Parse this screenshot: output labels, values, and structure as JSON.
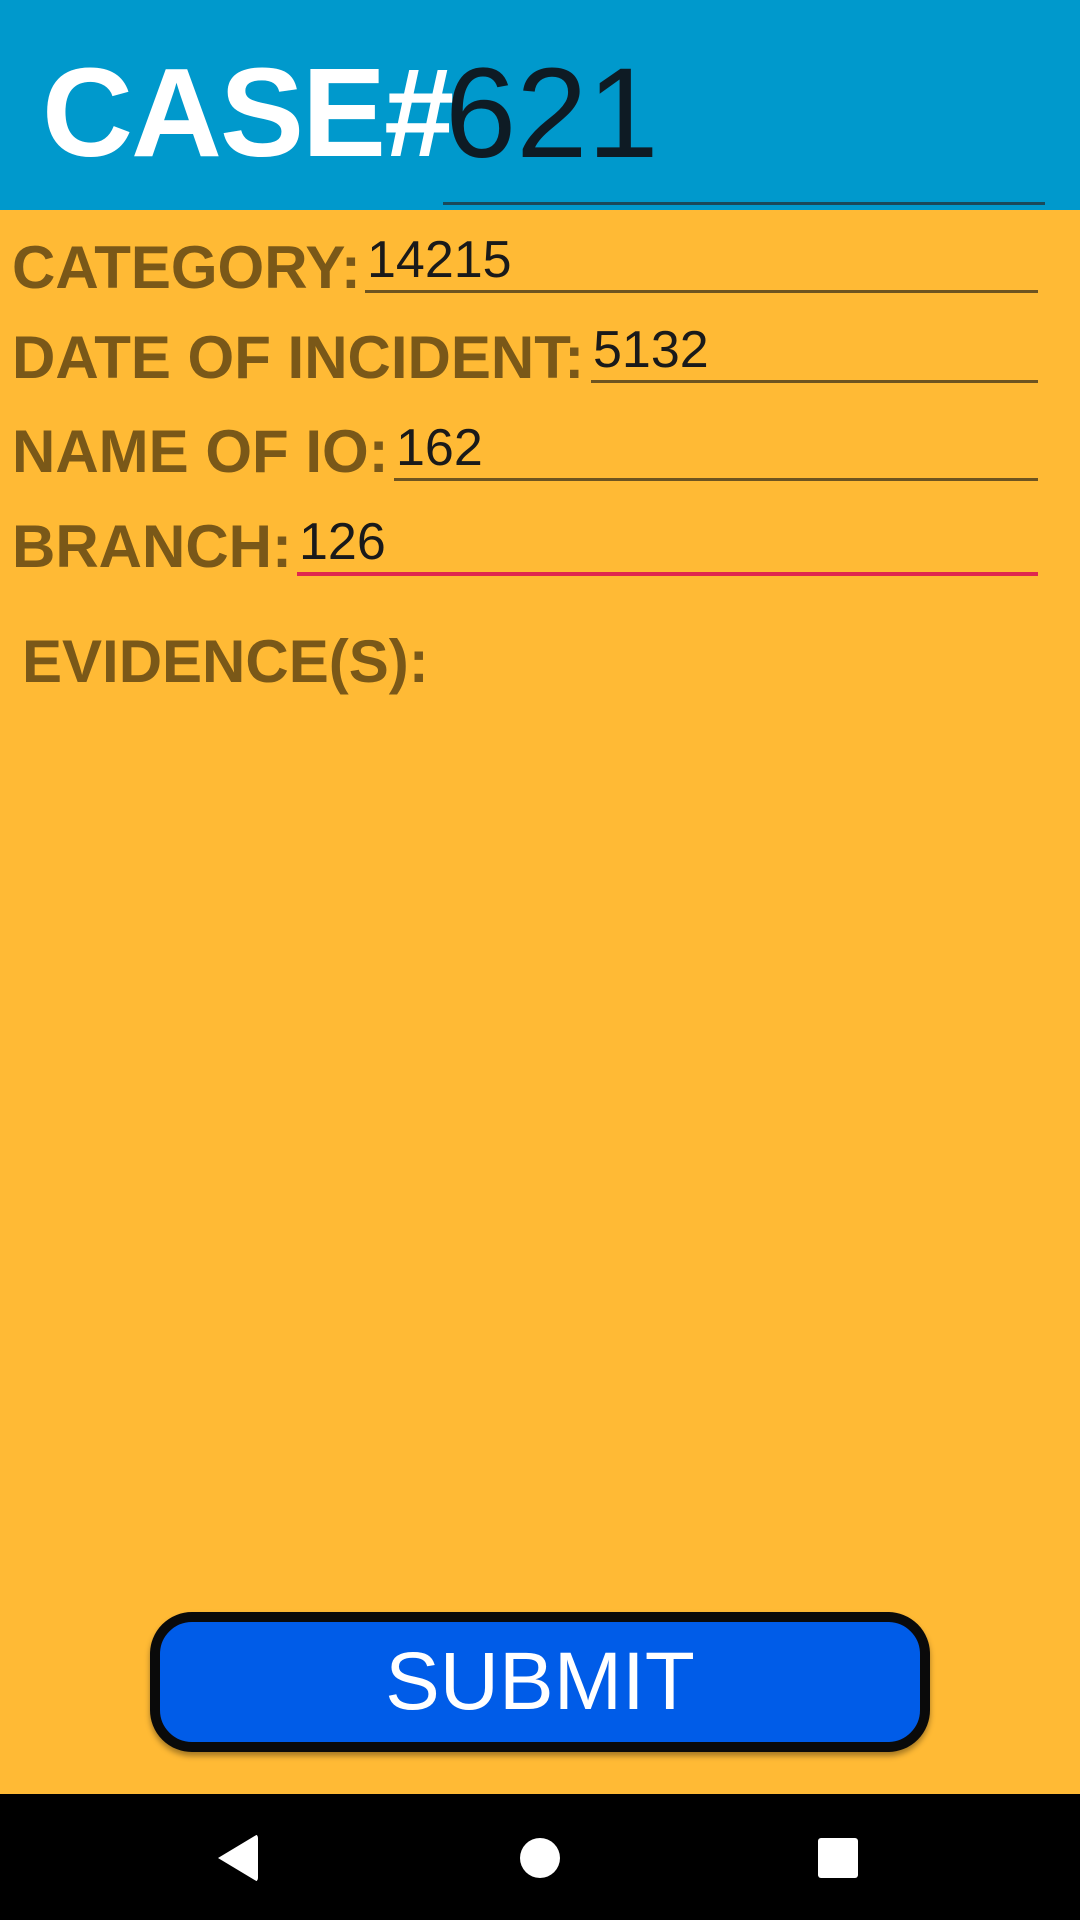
{
  "header": {
    "case_label": "CASE#",
    "case_number": "621",
    "background_color": "#0099CC"
  },
  "form": {
    "background_color": "#FFBA35",
    "fields": [
      {
        "label": "CATEGORY:",
        "value": "14215"
      },
      {
        "label": "DATE OF INCIDENT:",
        "value": "5132"
      },
      {
        "label": "NAME OF IO:",
        "value": "162"
      },
      {
        "label": "BRANCH:",
        "value": "126",
        "focused": true
      }
    ],
    "evidence_label": "EVIDENCE(S):",
    "focus_color": "#E0264E"
  },
  "submit": {
    "label": "SUBMIT",
    "color": "#005CE8"
  },
  "navbar": {
    "back_icon": "back-triangle-icon",
    "home_icon": "home-circle-icon",
    "recents_icon": "recents-square-icon"
  }
}
